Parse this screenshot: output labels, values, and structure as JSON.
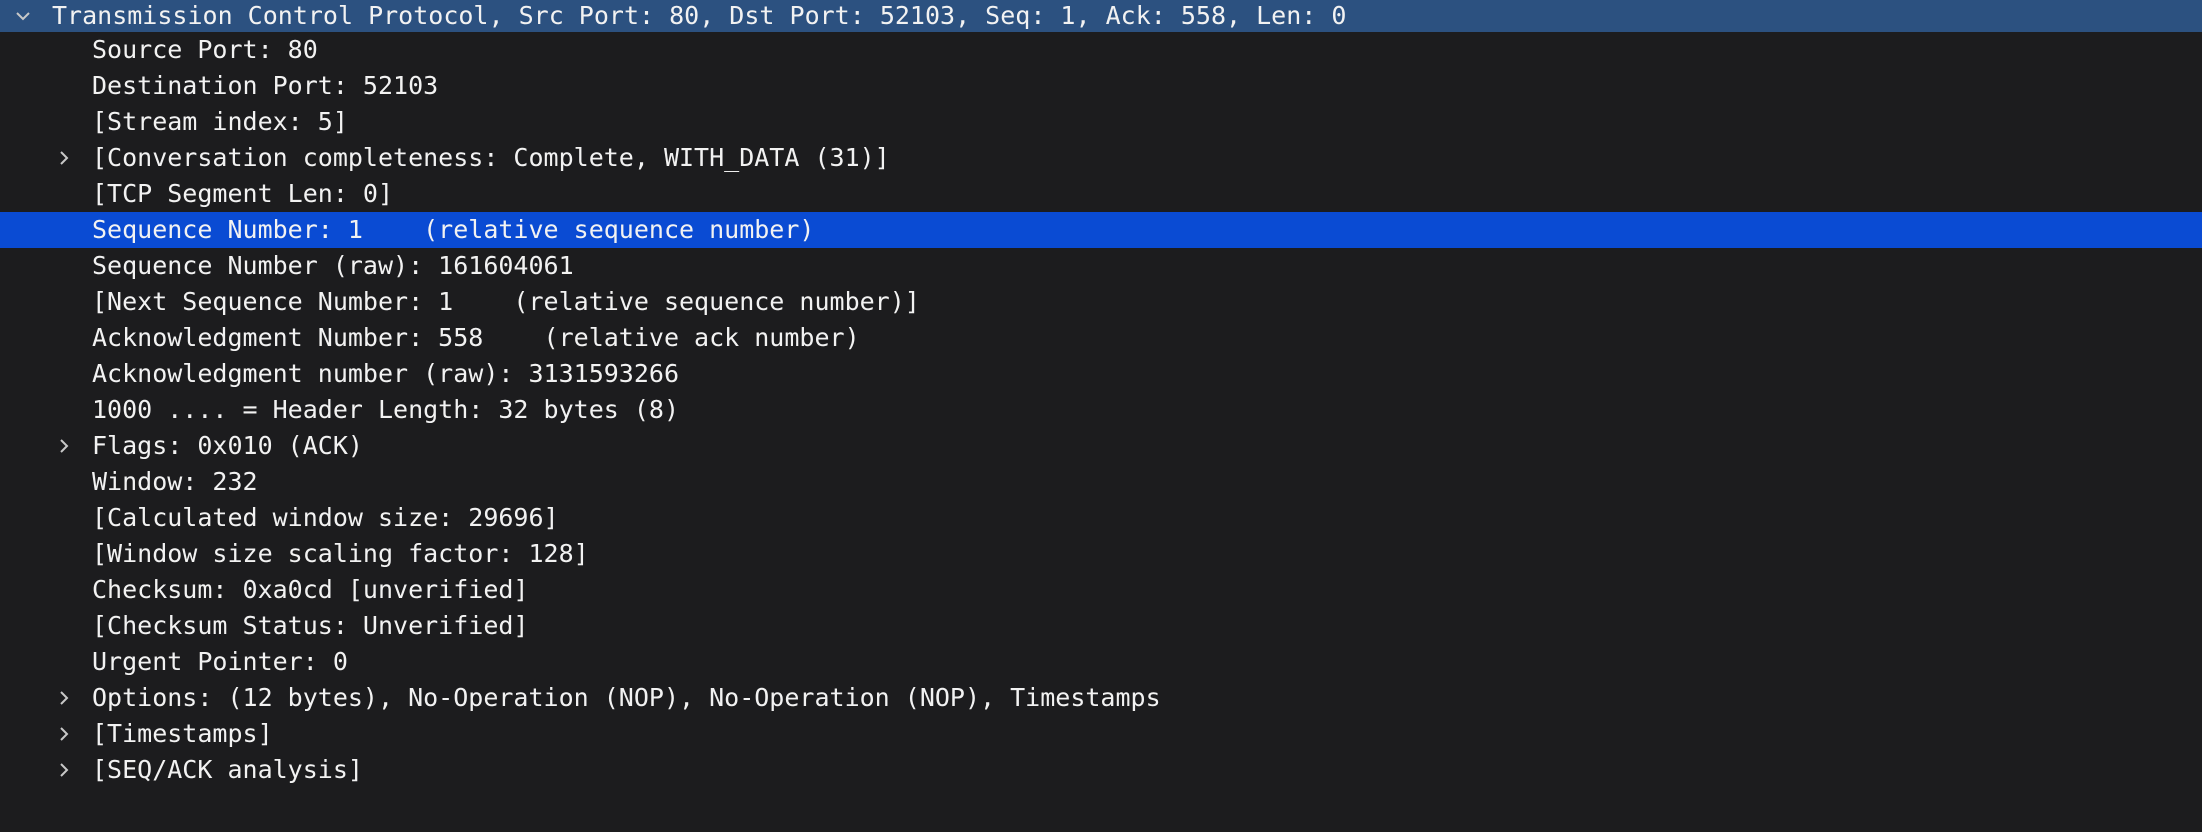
{
  "tree": {
    "header": {
      "label": "Transmission Control Protocol, Src Port: 80, Dst Port: 52103, Seq: 1, Ack: 558, Len: 0",
      "icon": "chevron-down-icon"
    },
    "rows": [
      {
        "label": "Source Port: 80",
        "expandable": false
      },
      {
        "label": "Destination Port: 52103",
        "expandable": false
      },
      {
        "label": "[Stream index: 5]",
        "expandable": false
      },
      {
        "label": "[Conversation completeness: Complete, WITH_DATA (31)]",
        "expandable": true
      },
      {
        "label": "[TCP Segment Len: 0]",
        "expandable": false
      },
      {
        "label": "Sequence Number: 1    (relative sequence number)",
        "expandable": false,
        "selected": true
      },
      {
        "label": "Sequence Number (raw): 161604061",
        "expandable": false
      },
      {
        "label": "[Next Sequence Number: 1    (relative sequence number)]",
        "expandable": false
      },
      {
        "label": "Acknowledgment Number: 558    (relative ack number)",
        "expandable": false
      },
      {
        "label": "Acknowledgment number (raw): 3131593266",
        "expandable": false
      },
      {
        "label": "1000 .... = Header Length: 32 bytes (8)",
        "expandable": false
      },
      {
        "label": "Flags: 0x010 (ACK)",
        "expandable": true
      },
      {
        "label": "Window: 232",
        "expandable": false
      },
      {
        "label": "[Calculated window size: 29696]",
        "expandable": false
      },
      {
        "label": "[Window size scaling factor: 128]",
        "expandable": false
      },
      {
        "label": "Checksum: 0xa0cd [unverified]",
        "expandable": false
      },
      {
        "label": "[Checksum Status: Unverified]",
        "expandable": false
      },
      {
        "label": "Urgent Pointer: 0",
        "expandable": false
      },
      {
        "label": "Options: (12 bytes), No-Operation (NOP), No-Operation (NOP), Timestamps",
        "expandable": true
      },
      {
        "label": "[Timestamps]",
        "expandable": true
      },
      {
        "label": "[SEQ/ACK analysis]",
        "expandable": true
      }
    ]
  },
  "colors": {
    "background": "#1c1c1e",
    "header_background": "#2c5180",
    "selected_background": "#0a4bd3",
    "text": "#f2f2f2",
    "chevron": "#c8c8c8"
  }
}
